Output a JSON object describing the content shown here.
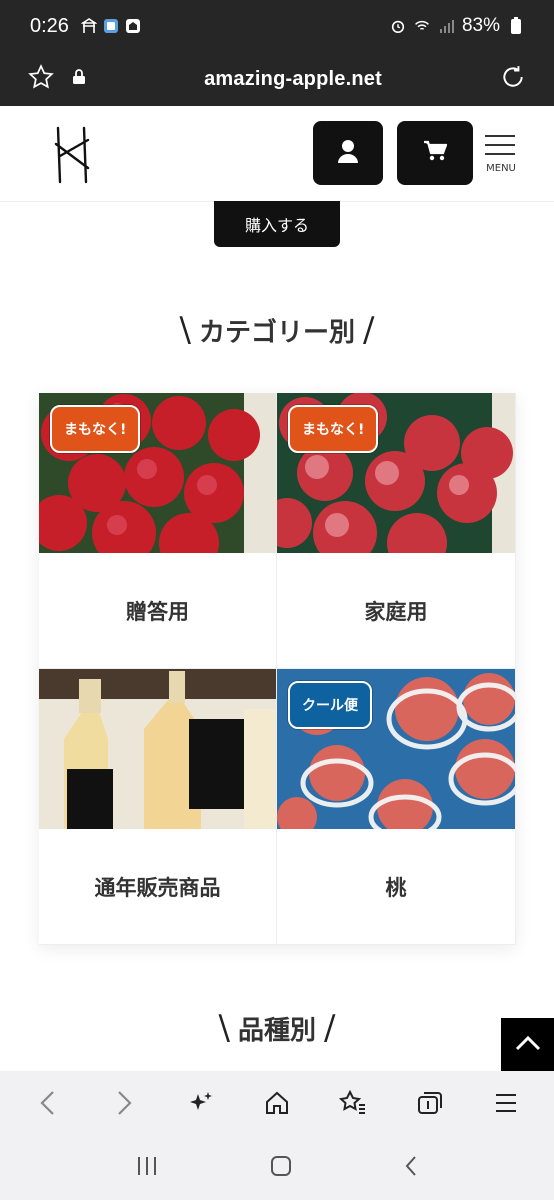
{
  "status_bar": {
    "time": "0:26",
    "battery": "83%"
  },
  "browser": {
    "url": "amazing-apple.net"
  },
  "header": {
    "menu_label": "MENU"
  },
  "buy_button": "購入する",
  "category_section": {
    "title": "カテゴリー別",
    "cards": [
      {
        "label": "贈答用",
        "badge": "まもなく!",
        "badge_color": "#e0541a"
      },
      {
        "label": "家庭用",
        "badge": "まもなく!",
        "badge_color": "#e0541a"
      },
      {
        "label": "通年販売商品",
        "badge": "",
        "badge_color": ""
      },
      {
        "label": "桃",
        "badge": "クール便",
        "badge_color": "#0e62a0"
      }
    ]
  },
  "variety_section": {
    "title": "品種別"
  }
}
